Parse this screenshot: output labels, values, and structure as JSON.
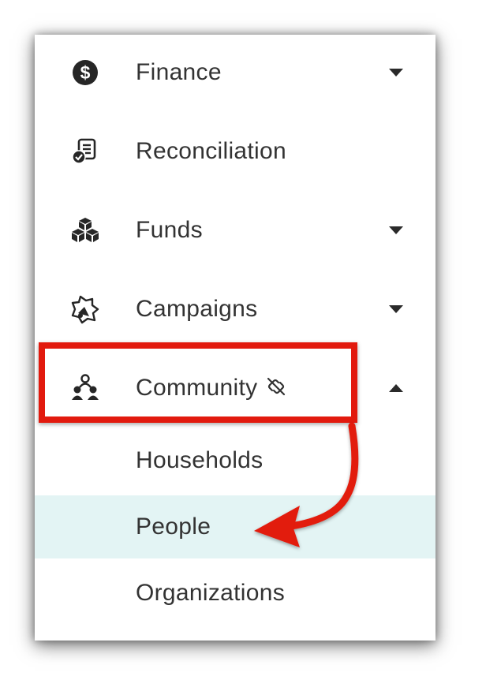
{
  "menu": {
    "items": [
      {
        "label": "Finance",
        "icon": "dollar-circle-icon",
        "caret": "down"
      },
      {
        "label": "Reconciliation",
        "icon": "document-check-icon",
        "caret": null
      },
      {
        "label": "Funds",
        "icon": "stacked-boxes-icon",
        "caret": "down"
      },
      {
        "label": "Campaigns",
        "icon": "megaphone-icon",
        "caret": "down"
      },
      {
        "label": "Community",
        "icon": "people-group-icon",
        "extra_icon": "unlink-icon",
        "caret": "up"
      }
    ],
    "community_submenu": [
      {
        "label": "Households",
        "active": false
      },
      {
        "label": "People",
        "active": true
      },
      {
        "label": "Organizations",
        "active": false
      }
    ]
  },
  "colors": {
    "text": "#333333",
    "active_background": "#e3f4f4",
    "annotation_red": "#e21a0e"
  }
}
